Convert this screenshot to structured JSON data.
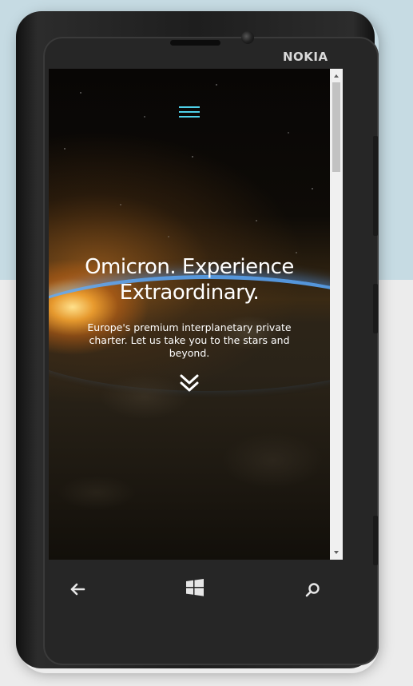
{
  "device": {
    "brand": "NOKIA",
    "icons": [
      "back-arrow-icon",
      "windows-logo-icon",
      "search-icon"
    ]
  },
  "hero": {
    "title": "Omicron. Experience Extraordinary.",
    "subtitle": "Europe's premium interplanetary private charter. Let us take you to the stars and beyond.",
    "icons": [
      "hamburger-menu-icon",
      "double-chevron-down-icon"
    ]
  },
  "colors": {
    "menu_icon": "#4fd0e8",
    "text": "#ffffff",
    "phone_body": "#1e1e1e",
    "background_top": "#c6dbe3",
    "background_bottom": "#ececec"
  }
}
